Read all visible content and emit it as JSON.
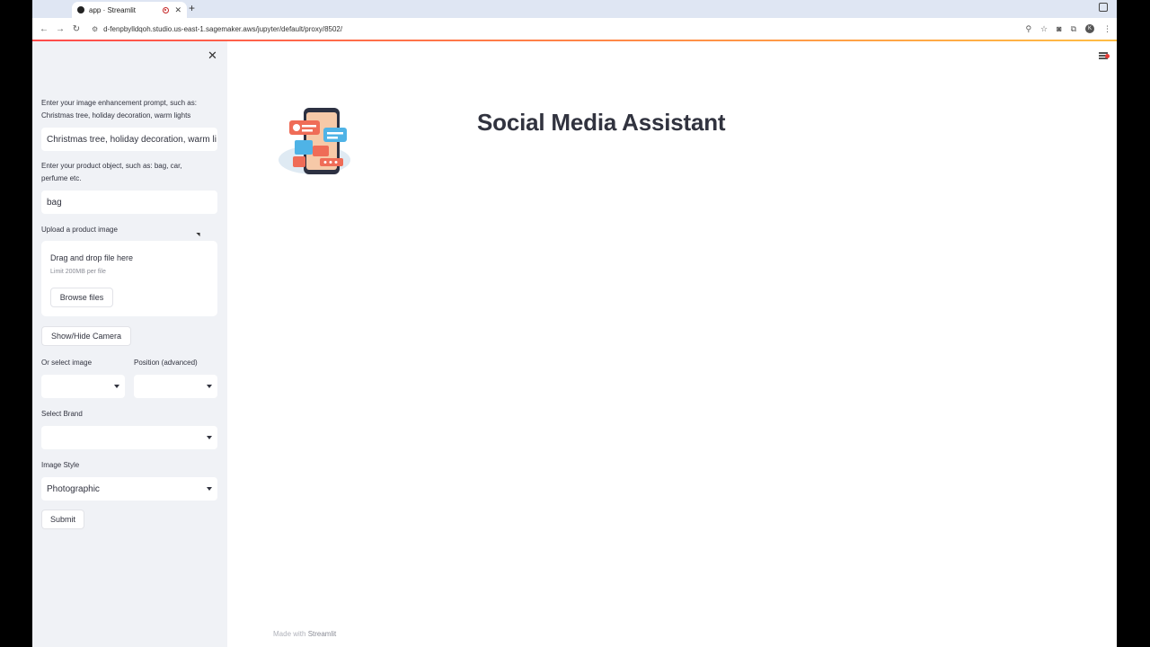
{
  "browser": {
    "tab_title": "app · Streamlit",
    "new_tab": "+",
    "url": "d-fenpbylldqoh.studio.us-east-1.sagemaker.aws/jupyter/default/proxy/8502/",
    "avatar_letter": "K"
  },
  "sidebar": {
    "prompt_label": "Enter your image enhancement prompt, such as: Christmas tree, holiday decoration, warm lights",
    "prompt_value": "Christmas tree, holiday decoration, warm li",
    "object_label": "Enter your product object, such as: bag, car, perfume etc.",
    "object_value": "bag",
    "upload_label": "Upload a product image",
    "drop_title": "Drag and drop file here",
    "drop_limit": "Limit 200MB per file",
    "browse_label": "Browse files",
    "camera_label": "Show/Hide Camera",
    "select_image_label": "Or select image",
    "position_label": "Position (advanced)",
    "select_image_value": "",
    "position_value": "",
    "brand_label": "Select Brand",
    "brand_value": "",
    "style_label": "Image Style",
    "style_value": "Photographic",
    "submit_label": "Submit"
  },
  "main": {
    "title": "Social Media Assistant",
    "footer_prefix": "Made with ",
    "footer_brand": "Streamlit"
  },
  "colors": {
    "accent": "#ff4b4b",
    "sidebar_bg": "#f0f2f6",
    "text": "#31333f"
  }
}
